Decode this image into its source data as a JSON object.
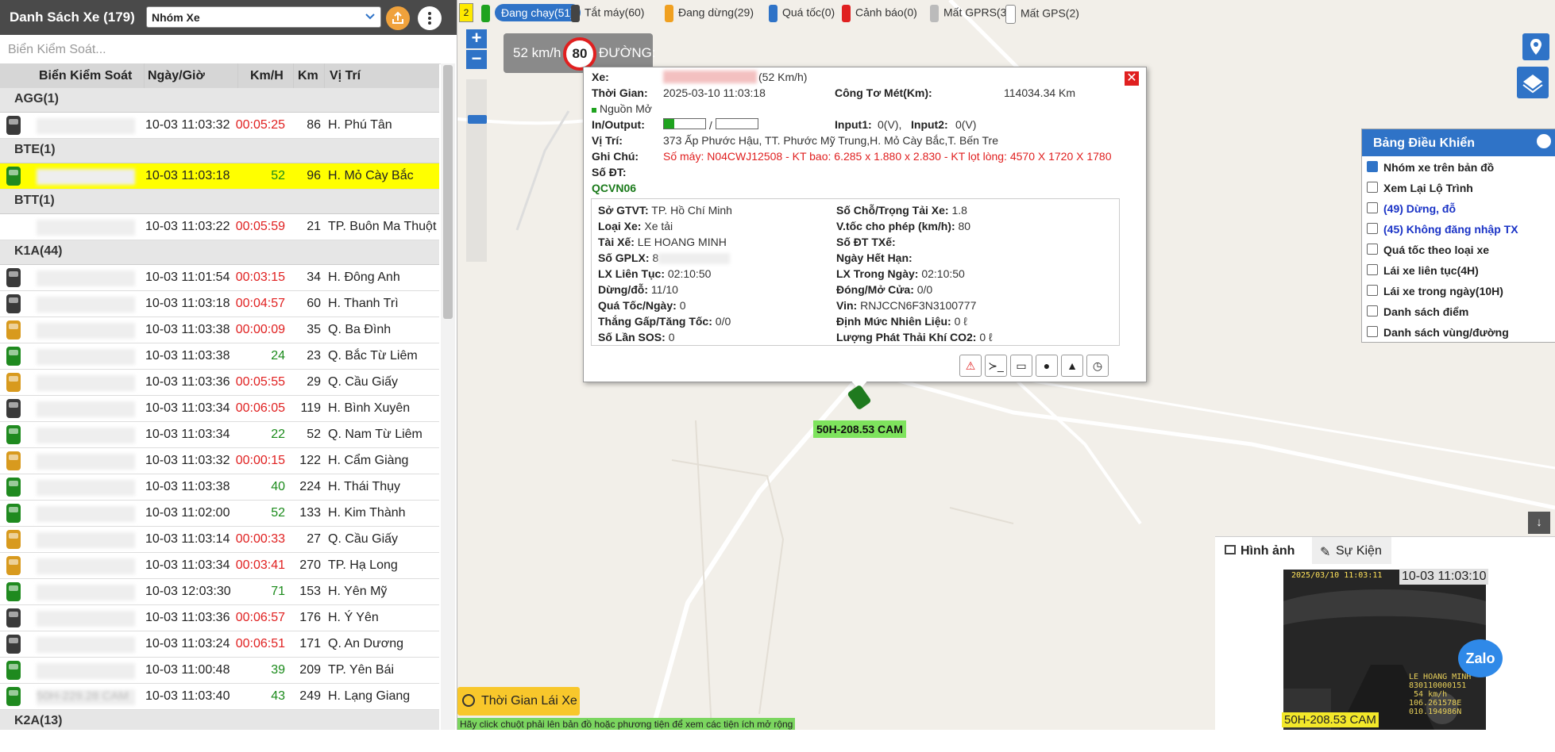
{
  "left": {
    "title": "Danh Sách Xe (179)",
    "group_select": "Nhóm Xe",
    "search_placeholder": "Biển Kiểm Soát...",
    "columns": [
      "Biển Kiểm Soát",
      "Ngày/Giờ",
      "Km/H",
      "Km",
      "Vị Trí"
    ],
    "groups": [
      {
        "name": "AGG(1)",
        "rows": [
          {
            "plate": "",
            "time": "10-03 11:03:32",
            "speed": "00:05:25",
            "speed_type": "stop",
            "km": "86",
            "loc": "H. Phú Tân",
            "car": "gray"
          }
        ]
      },
      {
        "name": "BTE(1)",
        "rows": [
          {
            "plate": "",
            "time": "10-03 11:03:18",
            "speed": "52",
            "speed_type": "run",
            "km": "96",
            "loc": "H. Mỏ Cày Bắc",
            "car": "green",
            "highlight": true
          }
        ]
      },
      {
        "name": "BTT(1)",
        "rows": [
          {
            "plate": "",
            "time": "10-03 11:03:22",
            "speed": "00:05:59",
            "speed_type": "stop",
            "km": "21",
            "loc": "TP. Buôn Ma Thuột",
            "car": "none"
          }
        ]
      },
      {
        "name": "K1A(44)",
        "rows": [
          {
            "plate": "",
            "time": "10-03 11:01:54",
            "speed": "00:03:15",
            "speed_type": "stop",
            "km": "34",
            "loc": "H. Đông Anh",
            "car": "gray"
          },
          {
            "plate": "",
            "time": "10-03 11:03:18",
            "speed": "00:04:57",
            "speed_type": "stop",
            "km": "60",
            "loc": "H. Thanh Trì",
            "car": "gray"
          },
          {
            "plate": "",
            "time": "10-03 11:03:38",
            "speed": "00:00:09",
            "speed_type": "stop",
            "km": "35",
            "loc": "Q. Ba Đình",
            "car": "orange"
          },
          {
            "plate": "",
            "time": "10-03 11:03:38",
            "speed": "24",
            "speed_type": "run",
            "km": "23",
            "loc": "Q. Bắc Từ Liêm",
            "car": "green"
          },
          {
            "plate": "",
            "time": "10-03 11:03:36",
            "speed": "00:05:55",
            "speed_type": "stop",
            "km": "29",
            "loc": "Q. Cầu Giấy",
            "car": "orange"
          },
          {
            "plate": "",
            "time": "10-03 11:03:34",
            "speed": "00:06:05",
            "speed_type": "stop",
            "km": "119",
            "loc": "H. Bình Xuyên",
            "car": "gray"
          },
          {
            "plate": "",
            "time": "10-03 11:03:34",
            "speed": "22",
            "speed_type": "run",
            "km": "52",
            "loc": "Q. Nam Từ Liêm",
            "car": "green"
          },
          {
            "plate": "",
            "time": "10-03 11:03:32",
            "speed": "00:00:15",
            "speed_type": "stop",
            "km": "122",
            "loc": "H. Cẩm Giàng",
            "car": "orange"
          },
          {
            "plate": "",
            "time": "10-03 11:03:38",
            "speed": "40",
            "speed_type": "run",
            "km": "224",
            "loc": "H. Thái Thụy",
            "car": "green"
          },
          {
            "plate": "",
            "time": "10-03 11:02:00",
            "speed": "52",
            "speed_type": "run",
            "km": "133",
            "loc": "H. Kim Thành",
            "car": "green"
          },
          {
            "plate": "",
            "time": "10-03 11:03:14",
            "speed": "00:00:33",
            "speed_type": "stop",
            "km": "27",
            "loc": "Q. Cầu Giấy",
            "car": "orange"
          },
          {
            "plate": "",
            "time": "10-03 11:03:34",
            "speed": "00:03:41",
            "speed_type": "stop",
            "km": "270",
            "loc": "TP. Hạ Long",
            "car": "orange"
          },
          {
            "plate": "",
            "time": "10-03 12:03:30",
            "speed": "71",
            "speed_type": "run",
            "km": "153",
            "loc": "H. Yên Mỹ",
            "car": "green"
          },
          {
            "plate": "",
            "time": "10-03 11:03:36",
            "speed": "00:06:57",
            "speed_type": "stop",
            "km": "176",
            "loc": "H. Ý Yên",
            "car": "gray"
          },
          {
            "plate": "",
            "time": "10-03 11:03:24",
            "speed": "00:06:51",
            "speed_type": "stop",
            "km": "171",
            "loc": "Q. An Dương",
            "car": "gray"
          },
          {
            "plate": "",
            "time": "10-03 11:00:48",
            "speed": "39",
            "speed_type": "run",
            "km": "209",
            "loc": "TP. Yên Bái",
            "car": "green"
          },
          {
            "plate": "50H-229.28 CAM",
            "time": "10-03 11:03:40",
            "speed": "43",
            "speed_type": "run",
            "km": "249",
            "loc": "H. Lạng Giang",
            "car": "green"
          }
        ]
      },
      {
        "name": "K2A(13)",
        "rows": []
      }
    ]
  },
  "filters": {
    "badge": "2",
    "items": [
      {
        "label": "Đang chạy(51)",
        "color": "#1fa31f",
        "active": true
      },
      {
        "label": "Tắt máy(60)",
        "color": "#444444"
      },
      {
        "label": "Đang dừng(29)",
        "color": "#f0a020"
      },
      {
        "label": "Quá tốc(0)",
        "color": "#2f73c7"
      },
      {
        "label": "Cảnh báo(0)",
        "color": "#e02020"
      },
      {
        "label": "Mất GPRS(39)",
        "color": "#bbbbbb"
      },
      {
        "label": "Mất GPS(2)",
        "color": "#ffffff"
      }
    ]
  },
  "speed_widget": {
    "current": "52 km/h",
    "limit": "80",
    "road_label": "ĐƯỜNG:"
  },
  "popup": {
    "xe_label": "Xe:",
    "xe_speed": "(52 Km/h)",
    "time_label": "Thời Gian:",
    "time_value": "2025-03-10 11:03:18",
    "odo_label": "Công Tơ Mét(Km):",
    "odo_value": "114034.34 Km",
    "power": "Nguồn Mở",
    "io_label": "In/Output:",
    "input_label": "Input1:",
    "input_value": "0(V),",
    "input2_label": "Input2:",
    "input2_value": "0(V)",
    "pos_label": "Vị Trí:",
    "pos_value": "373 Ấp Phước Hậu, TT. Phước Mỹ Trung,H. Mỏ Cày Bắc,T. Bến Tre",
    "note_label": "Ghi Chú:",
    "note_value": "Số máy: N04CWJ12508 - KT bao: 6.285 x 1.880 x 2.830 - KT lọt lòng: 4570 X 1720 X 1780",
    "phone_label": "Số ĐT:",
    "qcvn": "QCVN06",
    "details": {
      "sgtvt_label": "Sở GTVT:",
      "sgtvt": "TP. Hồ Chí Minh",
      "seats_label": "Số Chỗ/Trọng Tải Xe:",
      "seats": "1.8",
      "type_label": "Loại Xe:",
      "type": "Xe tải",
      "maxspeed_label": "V.tốc cho phép (km/h):",
      "maxspeed": "80",
      "driver_label": "Tài Xế:",
      "driver": "LE HOANG MINH",
      "driver_phone_label": "Số ĐT TXế:",
      "license_label": "Số GPLX:",
      "license": "8",
      "expiry_label": "Ngày Hết Hạn:",
      "cont_label": "LX Liên Tục:",
      "cont": "02:10:50",
      "inday_label": "LX Trong Ngày:",
      "inday": "02:10:50",
      "stops_label": "Dừng/đỗ:",
      "stops": "11/10",
      "door_label": "Đóng/Mở Cửa:",
      "door": "0/0",
      "overspeed_label": "Quá Tốc/Ngày:",
      "overspeed": "0",
      "vin_label": "Vin:",
      "vin": "RNJCCN6F3N3100777",
      "brake_label": "Thắng Gấp/Tăng Tốc:",
      "brake": "0/0",
      "fuel_label": "Định Mức Nhiên Liệu:",
      "fuel": "0 ℓ",
      "sos_label": "Số Lần SOS:",
      "sos": "0",
      "co2_label": "Lượng Phát Thải Khí CO2:",
      "co2": "0 ℓ"
    },
    "tools": [
      "⚠",
      "≻_",
      "▭",
      "●",
      "▲",
      "◷"
    ]
  },
  "vehicle_label": "50H-208.53 CAM",
  "drive_time_button": "Thời Gian Lái Xe",
  "hint": "Hãy click chuột phải lên bản đồ hoặc phương tiện để xem các tiện ích mở rộng",
  "control_panel": {
    "title": "Bảng Điều Khiển",
    "items": [
      {
        "label": "Nhóm xe trên bản đồ",
        "checked": true
      },
      {
        "label": "Xem Lại Lộ Trình"
      },
      {
        "label": "(49) Dừng, đỗ",
        "blue": true
      },
      {
        "label": "(45) Không đăng nhập TX",
        "blue": true
      },
      {
        "label": "Quá tốc theo loại xe"
      },
      {
        "label": "Lái xe liên tục(4H)"
      },
      {
        "label": "Lái xe trong ngày(10H)"
      },
      {
        "label": "Danh sách điểm"
      },
      {
        "label": "Danh sách vùng/đường"
      }
    ]
  },
  "image_panel": {
    "tab_image": "Hình ảnh",
    "tab_event": "Sự Kiện",
    "cam_time": "10-03 11:03:10",
    "cam_stamp": "2025/03/10 11:03:11",
    "cam_overlay": "LE HOANG MINH\n830110000151\n 54 km/h\n106.261578E\n010.194986N",
    "cam_plate": "50H-208.53 CAM",
    "zalo": "Zalo"
  }
}
